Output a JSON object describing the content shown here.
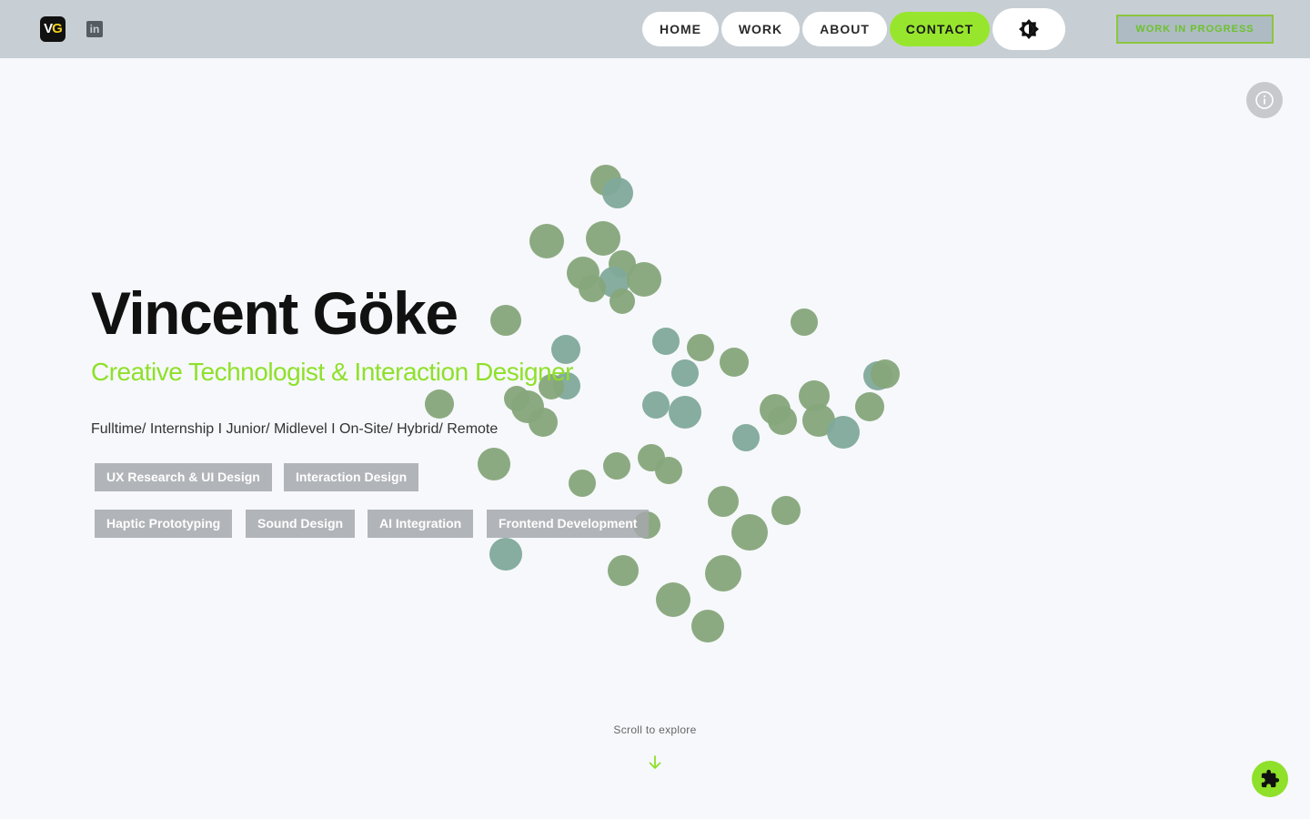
{
  "header": {
    "logo": {
      "v": "V",
      "g": "G",
      "icon": "vg-logo-icon"
    },
    "linkedin": {
      "glyph": "in",
      "icon": "linkedin-icon"
    },
    "nav": {
      "home": "HOME",
      "work": "WORK",
      "about": "ABOUT",
      "contact": "CONTACT"
    },
    "theme_toggle_icon": "brightness-icon",
    "badge": "WORK IN PROGRESS"
  },
  "hero": {
    "name": "Vincent Göke",
    "role": "Creative Technologist & Interaction Designer",
    "employment": "Fulltime/ Internship I Junior/ Midlevel I On-Site/ Hybrid/ Remote",
    "tags": [
      "UX Research & UI Design",
      "Interaction Design",
      "Haptic Prototyping",
      "Sound Design",
      "AI Integration",
      "Frontend Development"
    ]
  },
  "scroll_hint": "Scroll to explore",
  "colors": {
    "accent": "#8fe02a",
    "header": "#c7cfd4",
    "background": "#f6f8fb",
    "dot_green": "#86a57a",
    "dot_teal": "#7fa99a"
  },
  "icons": {
    "info": "info-icon",
    "scroll": "arrow-down-icon",
    "puzzle": "puzzle-icon"
  }
}
